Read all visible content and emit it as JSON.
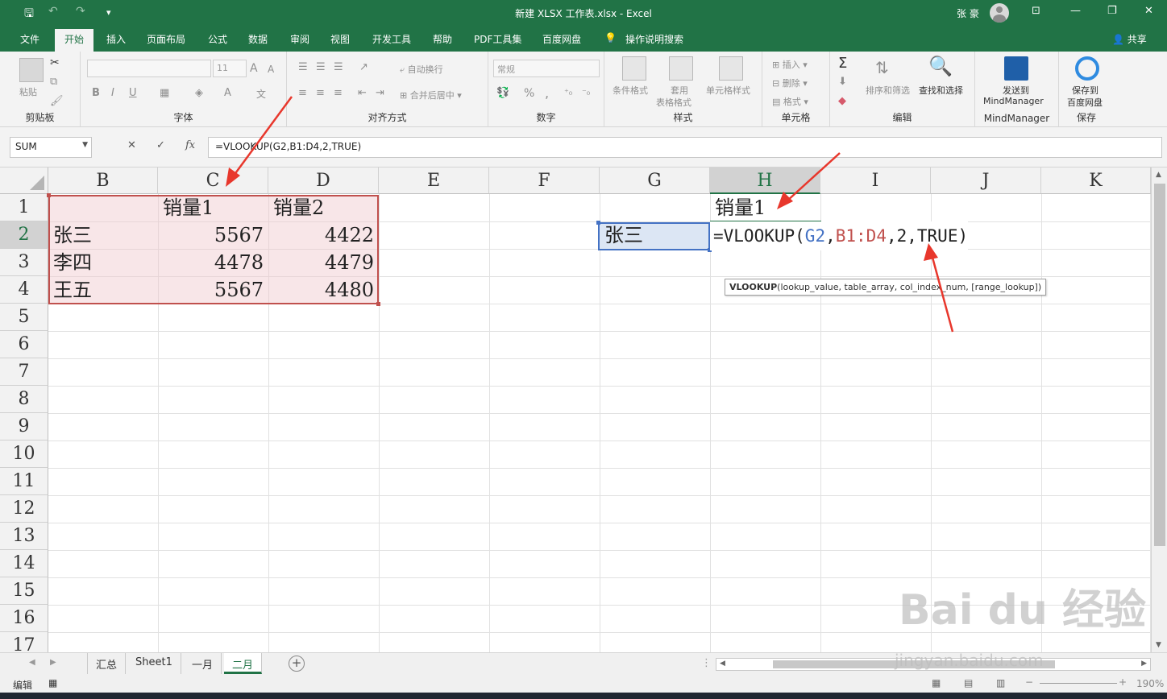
{
  "window": {
    "title": "新建 XLSX 工作表.xlsx  -  Excel",
    "user_name": "张 豪",
    "minimize": "—",
    "restore": "❐",
    "close": "✕",
    "ribbon_display": "⊡"
  },
  "tabs": [
    {
      "label": "文件"
    },
    {
      "label": "开始"
    },
    {
      "label": "插入"
    },
    {
      "label": "页面布局"
    },
    {
      "label": "公式"
    },
    {
      "label": "数据"
    },
    {
      "label": "审阅"
    },
    {
      "label": "视图"
    },
    {
      "label": "开发工具"
    },
    {
      "label": "帮助"
    },
    {
      "label": "PDF工具集"
    },
    {
      "label": "百度网盘"
    },
    {
      "label": "操作说明搜索"
    }
  ],
  "active_tab": "开始",
  "share_label": "共享",
  "ribbon": {
    "clipboard": {
      "label": "剪贴板",
      "paste": "粘贴"
    },
    "font": {
      "label": "字体",
      "size": "11",
      "bold": "B",
      "italic": "I",
      "underline": "U"
    },
    "alignment": {
      "label": "对齐方式",
      "wrap": "自动换行",
      "merge": "合并后居中"
    },
    "number": {
      "label": "数字",
      "format": "常规",
      "percent": "%",
      "comma": ","
    },
    "styles": {
      "label": "样式",
      "conditional": "条件格式",
      "table_top": "套用",
      "table_bottom": "表格格式",
      "cell_styles": "单元格样式"
    },
    "cells": {
      "label": "单元格",
      "insert": "插入",
      "delete": "删除",
      "format": "格式"
    },
    "editing": {
      "label": "编辑",
      "sort": "排序和筛选",
      "find": "查找和选择"
    },
    "mindmanager": {
      "label": "MindManager",
      "send_top": "发送到",
      "send_bottom": "MindManager"
    },
    "save": {
      "label": "保存",
      "top": "保存到",
      "bottom": "百度网盘"
    }
  },
  "formula_bar": {
    "name_box": "SUM",
    "cancel": "✕",
    "enter": "✓",
    "fx": "fx",
    "formula": "=VLOOKUP(G2,B1:D4,2,TRUE)"
  },
  "columns": [
    "B",
    "C",
    "D",
    "E",
    "F",
    "G",
    "H",
    "I",
    "J",
    "K"
  ],
  "rows": [
    "1",
    "2",
    "3",
    "4",
    "5",
    "6",
    "7",
    "8",
    "9",
    "10",
    "11",
    "12",
    "13",
    "14",
    "15",
    "16",
    "17"
  ],
  "cells": {
    "C1": "销量1",
    "D1": "销量2",
    "B2": "张三",
    "C2": "5567",
    "D2": "4422",
    "B3": "李四",
    "C3": "4478",
    "D3": "4479",
    "B4": "王五",
    "C4": "5567",
    "D4": "4480",
    "G2": "张三",
    "H1": "销量1"
  },
  "edit_cell": {
    "prefix": "=VLOOKUP(",
    "ref1": "G2",
    "sep1": ",",
    "ref2": "B1:D4",
    "suffix": ",2,TRUE)"
  },
  "tooltip": {
    "func": "VLOOKUP",
    "args": "(lookup_value, table_array, col_index_num, [range_lookup])"
  },
  "sheets": [
    {
      "label": "汇总"
    },
    {
      "label": "Sheet1"
    },
    {
      "label": "一月"
    },
    {
      "label": "二月"
    }
  ],
  "active_sheet": "二月",
  "status": {
    "mode": "编辑",
    "zoom": "190%"
  },
  "watermark": {
    "main": "Bai du 经验",
    "sub": "jingyan.baidu.com"
  },
  "annotation_color": "#e8372c"
}
